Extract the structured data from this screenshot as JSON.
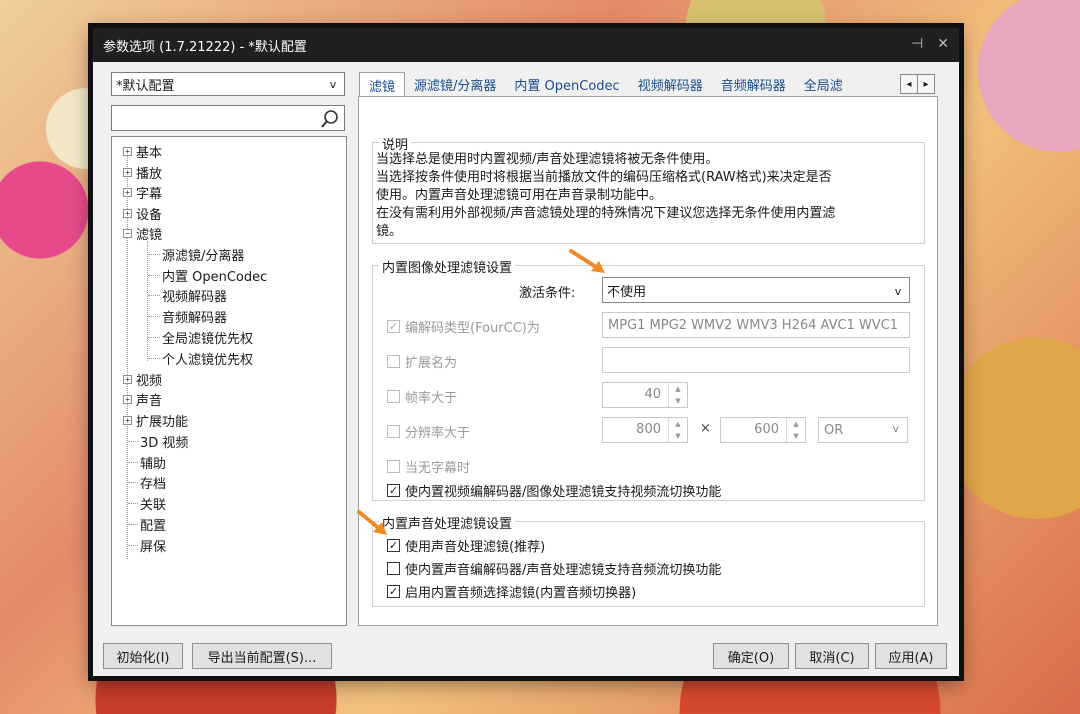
{
  "window": {
    "title": "参数选项 (1.7.21222) - *默认配置",
    "pin": "⊣",
    "close": "✕"
  },
  "profile": {
    "value": "*默认配置",
    "arrow": "v"
  },
  "search": {
    "placeholder": ""
  },
  "tree": {
    "items": [
      {
        "label": "基本",
        "expander": "+"
      },
      {
        "label": "播放",
        "expander": "+"
      },
      {
        "label": "字幕",
        "expander": "+"
      },
      {
        "label": "设备",
        "expander": "+"
      },
      {
        "label": "滤镜",
        "expander": "−"
      },
      {
        "label": "源滤镜/分离器"
      },
      {
        "label": "内置 OpenCodec"
      },
      {
        "label": "视频解码器"
      },
      {
        "label": "音频解码器"
      },
      {
        "label": "全局滤镜优先权"
      },
      {
        "label": "个人滤镜优先权"
      },
      {
        "label": "视频",
        "expander": "+"
      },
      {
        "label": "声音",
        "expander": "+"
      },
      {
        "label": "扩展功能",
        "expander": "+"
      },
      {
        "label": "3D 视频"
      },
      {
        "label": "辅助"
      },
      {
        "label": "存档"
      },
      {
        "label": "关联"
      },
      {
        "label": "配置"
      },
      {
        "label": "屏保"
      }
    ]
  },
  "tabs": [
    "滤镜",
    "源滤镜/分离器",
    "内置 OpenCodec",
    "视频解码器",
    "音频解码器",
    "全局滤"
  ],
  "tab_scroll": {
    "left": "◂",
    "right": "▸"
  },
  "description": {
    "legend": "说明",
    "lines": [
      "当选择总是使用时内置视频/声音处理滤镜将被无条件使用。",
      "当选择按条件使用时将根据当前播放文件的编码压缩格式(RAW格式)来决定是否",
      "使用。内置声音处理滤镜可用在声音录制功能中。",
      "在没有需利用外部视频/声音滤镜处理的特殊情况下建议您选择无条件使用内置滤",
      "镜。"
    ]
  },
  "image_group": {
    "legend": "内置图像处理滤镜设置",
    "activation_label": "激活条件:",
    "activation_value": "不使用",
    "activation_arrow": "v",
    "fourcc_label": "编解码类型(FourCC)为",
    "fourcc_value": "MPG1 MPG2 WMV2 WMV3 H264 AVC1 WVC1",
    "ext_label": "扩展名为",
    "ext_value": "",
    "fps_label": "帧率大于",
    "fps_value": "40",
    "res_label": "分辨率大于",
    "res_w": "800",
    "res_x": "×",
    "res_h": "600",
    "res_op": "OR",
    "res_op_arrow": "v",
    "nosub_label": "当无字幕时",
    "switch_label": "使内置视频编解码器/图像处理滤镜支持视频流切换功能",
    "checked_mark": "✓"
  },
  "audio_group": {
    "legend": "内置声音处理滤镜设置",
    "use_label": "使用声音处理滤镜(推荐)",
    "switch_label": "使内置声音编解码器/声音处理滤镜支持音频流切换功能",
    "selector_label": "启用内置音频选择滤镜(内置音频切换器)",
    "checked_mark": "✓"
  },
  "buttons": {
    "init": "初始化(I)",
    "export": "导出当前配置(S)...",
    "ok": "确定(O)",
    "cancel": "取消(C)",
    "apply": "应用(A)"
  },
  "colors": {
    "accent_arrow": "#f08a24",
    "tab_text": "#1a4c8c",
    "titlebar": "#202020"
  }
}
